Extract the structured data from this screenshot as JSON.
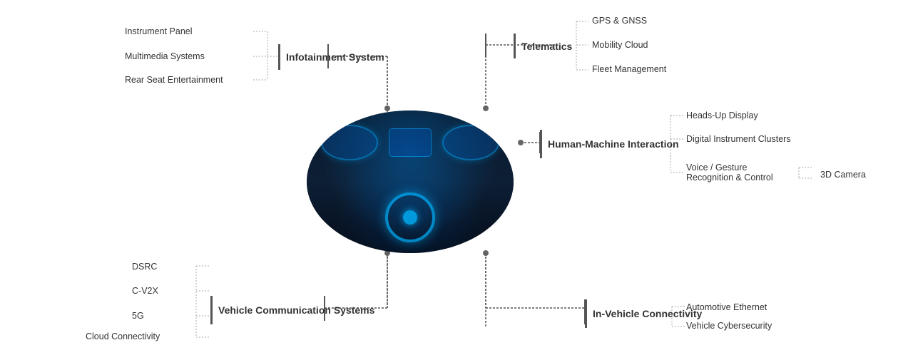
{
  "left": {
    "infotainment": {
      "label": "Infotainment\nSystem",
      "items": [
        "Instrument Panel",
        "Multimedia Systems",
        "Rear Seat Entertainment"
      ]
    },
    "vcs": {
      "label": "Vehicle\nCommunication\nSystems",
      "items": [
        "DSRC",
        "C-V2X",
        "5G",
        "Cloud Connectivity"
      ]
    }
  },
  "right": {
    "telematics": {
      "label": "Telematics",
      "items": [
        "GPS & GNSS",
        "Mobility Cloud",
        "Fleet Management"
      ]
    },
    "hmi": {
      "label": "Human-Machine\nInteraction",
      "items": [
        "Heads-Up Display",
        "Digital Instrument Clusters",
        "Voice / Gesture\nRecognition & Control",
        "3D\nCamera"
      ]
    },
    "ivc": {
      "label": "In-Vehicle\nConnectivity",
      "items": [
        "Automotive Ethernet",
        "Vehicle Cybersecurity"
      ]
    }
  }
}
